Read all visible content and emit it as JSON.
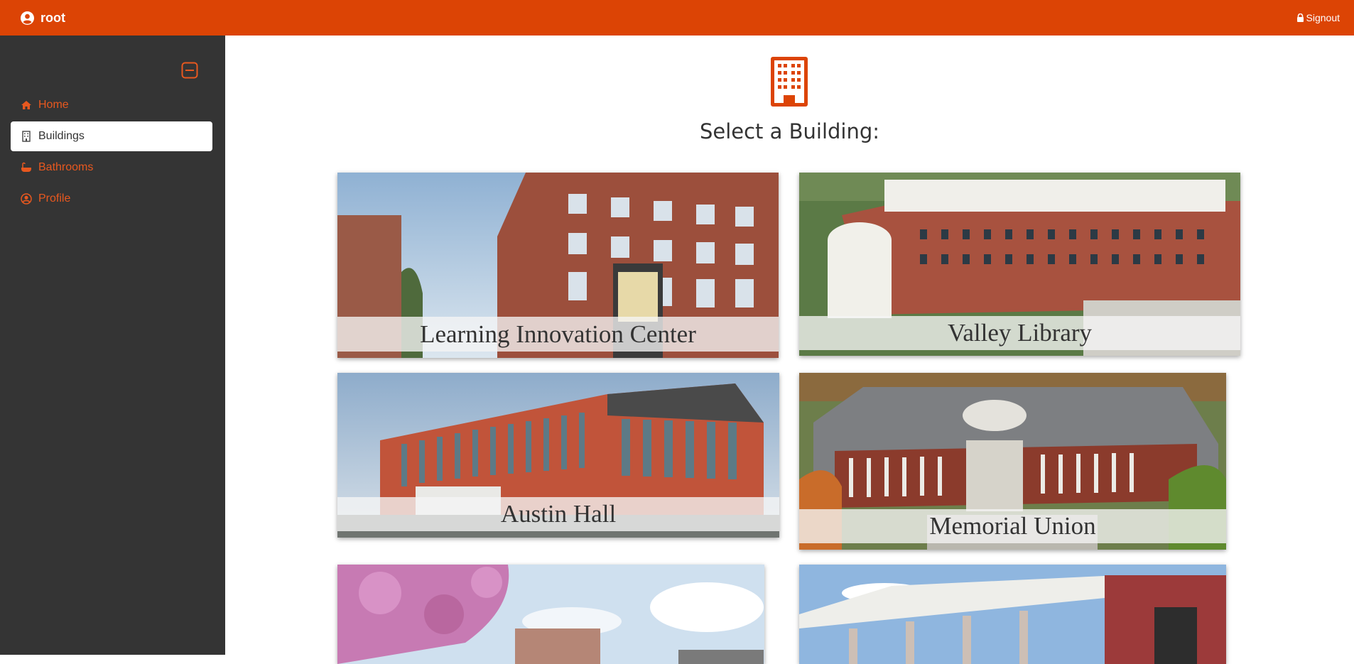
{
  "header": {
    "brand": "root",
    "signout_label": "Signout",
    "accent_color": "#dc4405"
  },
  "sidebar": {
    "toggle_icon": "collapse-icon",
    "items": [
      {
        "label": "Home",
        "icon": "home-icon",
        "active": false
      },
      {
        "label": "Buildings",
        "icon": "building-icon",
        "active": true
      },
      {
        "label": "Bathrooms",
        "icon": "bathtub-icon",
        "active": false
      },
      {
        "label": "Profile",
        "icon": "user-circle-icon",
        "active": false
      }
    ]
  },
  "main": {
    "icon": "building-icon",
    "title": "Select a Building:",
    "buildings": [
      {
        "name": "Learning Innovation Center"
      },
      {
        "name": "Valley Library"
      },
      {
        "name": "Austin Hall"
      },
      {
        "name": "Memorial Union"
      },
      {
        "name": ""
      },
      {
        "name": ""
      }
    ]
  }
}
